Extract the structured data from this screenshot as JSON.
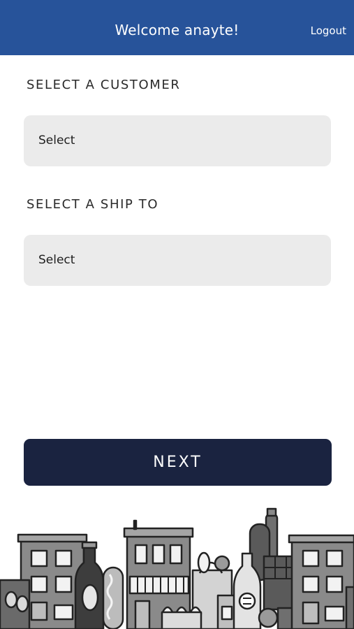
{
  "header": {
    "title": "Welcome anayte!",
    "logout_label": "Logout",
    "background_color": "#27539a"
  },
  "customer": {
    "label": "SELECT A CUSTOMER",
    "selected_value": "Select"
  },
  "ship_to": {
    "label": "SELECT A SHIP TO",
    "selected_value": "Select"
  },
  "actions": {
    "next_label": "NEXT",
    "next_color": "#1a2340"
  },
  "footer_illustration": {
    "icon": "city-grocery-skyline-illustration"
  }
}
